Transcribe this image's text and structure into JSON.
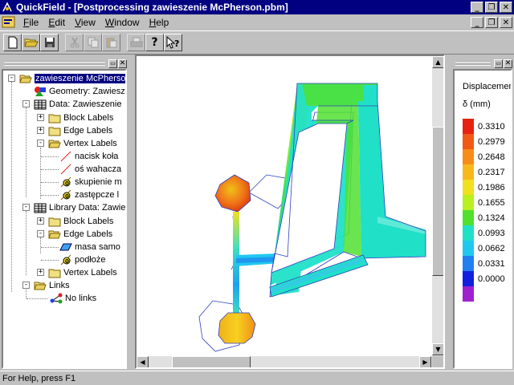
{
  "window": {
    "title": "QuickField - [Postprocessing zawieszenie McPherson.pbm]",
    "buttons": [
      "_",
      "❐",
      "✕"
    ]
  },
  "menu": {
    "items": [
      {
        "label": "File",
        "u": "F",
        "rest": "ile"
      },
      {
        "label": "Edit",
        "u": "E",
        "rest": "dit"
      },
      {
        "label": "View",
        "u": "V",
        "rest": "iew"
      },
      {
        "label": "Window",
        "u": "W",
        "rest": "indow"
      },
      {
        "label": "Help",
        "u": "H",
        "rest": "elp"
      }
    ]
  },
  "toolbar": {
    "new": "new-document-icon",
    "open": "open-folder-icon",
    "save": "save-disk-icon",
    "cut": "scissors-icon",
    "copy": "copy-icon",
    "paste": "paste-icon",
    "print": "printer-icon",
    "help": "help-question-icon",
    "context_help": "context-help-icon"
  },
  "tree": {
    "root": "zawieszenie McPherson",
    "geometry": "Geometry: Zawieszenie",
    "data": "Data: Zawieszenie",
    "data_block": "Block Labels",
    "data_edge": "Edge Labels",
    "data_vertex": "Vertex Labels",
    "v1": "nacisk koła",
    "v2": "oś wahacza",
    "v3": "skupienie m",
    "v4": "zastępcze l",
    "library": "Library Data: Zawie",
    "lib_block": "Block Labels",
    "lib_edge": "Edge Labels",
    "e1": "masa samo",
    "e2": "podłoże",
    "lib_vertex": "Vertex Labels",
    "links": "Links",
    "no_links": "No links"
  },
  "legend": {
    "title": "Displacement",
    "unit": "δ (mm)",
    "entries": [
      {
        "color": "#e82010",
        "value": "0.3310"
      },
      {
        "color": "#f05a14",
        "value": "0.2979"
      },
      {
        "color": "#f88c18",
        "value": "0.2648"
      },
      {
        "color": "#f8b81c",
        "value": "0.2317"
      },
      {
        "color": "#f0e020",
        "value": "0.1986"
      },
      {
        "color": "#b8f020",
        "value": "0.1655"
      },
      {
        "color": "#50e030",
        "value": "0.1324"
      },
      {
        "color": "#20e0c8",
        "value": "0.0993"
      },
      {
        "color": "#20c8f0",
        "value": "0.0662"
      },
      {
        "color": "#2080f0",
        "value": "0.0331"
      },
      {
        "color": "#1020e0",
        "value": "0.0000"
      },
      {
        "color": "#a020d0",
        "value": ""
      }
    ]
  },
  "status": {
    "text": "For Help, press F1"
  }
}
